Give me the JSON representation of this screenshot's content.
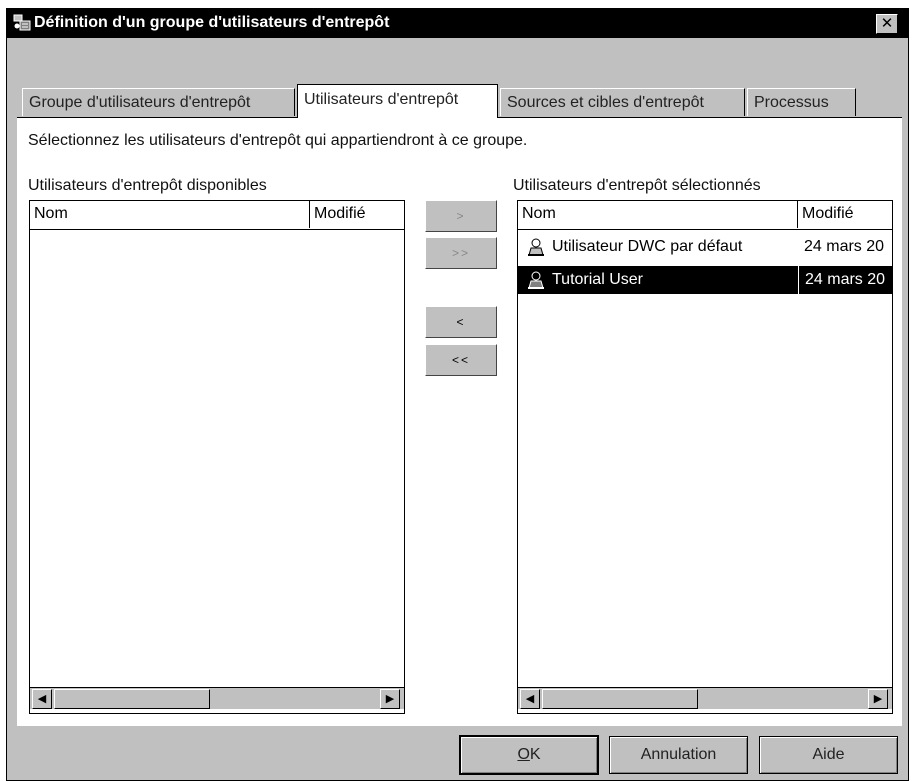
{
  "window": {
    "title": "Définition d'un groupe d'utilisateurs d'entrepôt",
    "close_glyph": "✕"
  },
  "tabs": [
    {
      "label": "Groupe d'utilisateurs d'entrepôt",
      "active": false
    },
    {
      "label": "Utilisateurs d'entrepôt",
      "active": true
    },
    {
      "label": "Sources et cibles d'entrepôt",
      "active": false
    },
    {
      "label": "Processus",
      "active": false
    }
  ],
  "instruction": "Sélectionnez les utilisateurs d'entrepôt qui appartiendront à ce groupe.",
  "available": {
    "label": "Utilisateurs d'entrepôt disponibles",
    "columns": [
      "Nom",
      "Modifié"
    ],
    "rows": []
  },
  "selected": {
    "label": "Utilisateurs d'entrepôt sélectionnés",
    "columns": [
      "Nom",
      "Modifié"
    ],
    "rows": [
      {
        "name": "Utilisateur DWC par défaut",
        "modified": "24 mars 20",
        "icon": "user-icon",
        "selected": false
      },
      {
        "name": "Tutorial User",
        "modified": "24 mars 20",
        "icon": "user-icon",
        "selected": true
      }
    ]
  },
  "move_buttons": {
    "add": ">",
    "add_all": ">>",
    "remove": "<",
    "remove_all": "<<"
  },
  "scroll": {
    "left_arrow": "◀",
    "right_arrow": "▶"
  },
  "footer": {
    "ok_mnemonic": "O",
    "ok_rest": "K",
    "cancel": "Annulation",
    "help": "Aide"
  },
  "colors": {
    "window_bg": "#c0c0c0",
    "titlebar": "#000000",
    "selection": "#000000"
  }
}
